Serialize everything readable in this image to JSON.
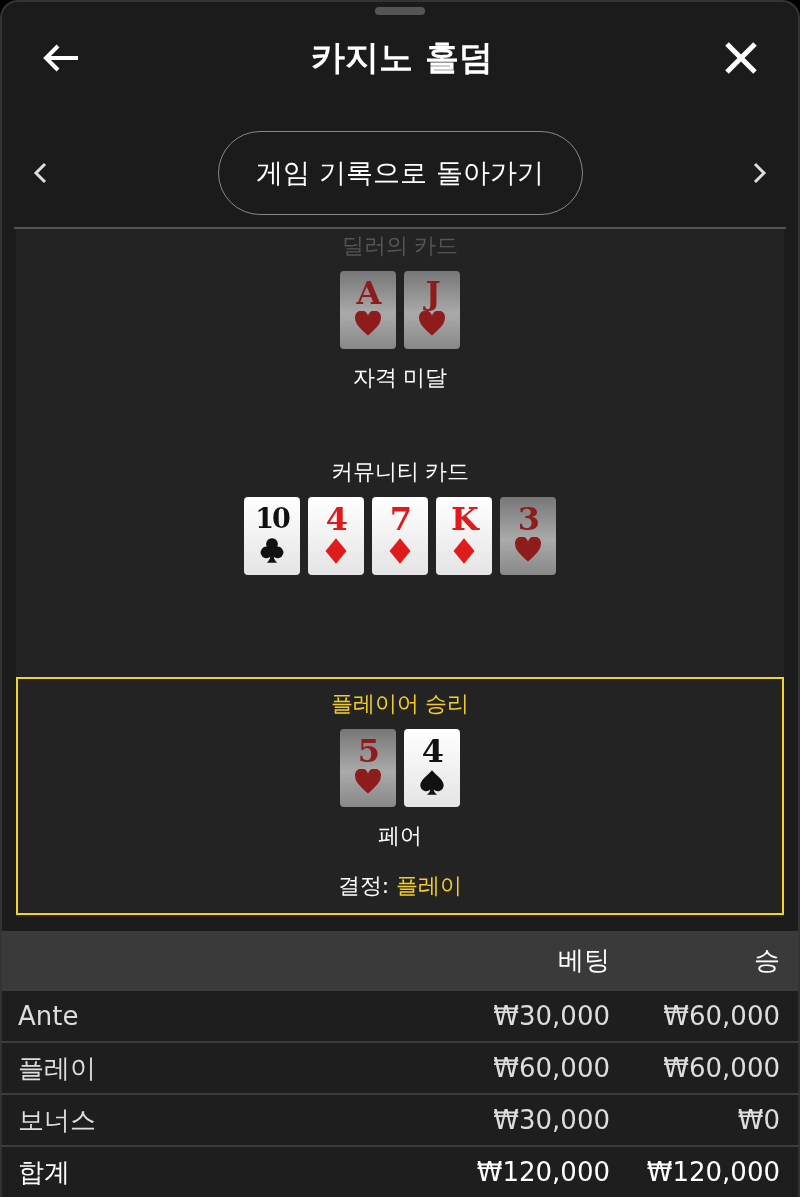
{
  "header": {
    "title": "카지노 홀덤"
  },
  "nav": {
    "back_to_history": "게임 기록으로 돌아가기"
  },
  "hands": [
    {
      "title": "딜러의 카드",
      "title_dimmed": true,
      "highlighted": false,
      "cards": [
        {
          "rank": "A",
          "kind": "hearts",
          "dimmed": true
        },
        {
          "rank": "J",
          "kind": "hearts",
          "dimmed": true
        }
      ],
      "result": "자격 미달"
    },
    {
      "title": "커뮤니티 카드",
      "title_dimmed": false,
      "highlighted": false,
      "cards": [
        {
          "rank": "10",
          "kind": "clubs",
          "dimmed": false
        },
        {
          "rank": "4",
          "kind": "diamonds",
          "dimmed": false
        },
        {
          "rank": "7",
          "kind": "diamonds",
          "dimmed": false
        },
        {
          "rank": "K",
          "kind": "diamonds",
          "dimmed": false
        },
        {
          "rank": "3",
          "kind": "hearts",
          "dimmed": true
        }
      ]
    },
    {
      "title": "플레이어 승리",
      "title_dimmed": false,
      "highlighted": true,
      "cards": [
        {
          "rank": "5",
          "kind": "hearts",
          "dimmed": true
        },
        {
          "rank": "4",
          "kind": "spades",
          "dimmed": false
        }
      ],
      "result": "페어",
      "decision": {
        "label": "결정:",
        "value": "플레이"
      }
    }
  ],
  "table": {
    "columns": [
      "베팅",
      "승"
    ],
    "rows": [
      {
        "name": "Ante",
        "bet": "₩30,000",
        "win": "₩60,000",
        "total": false
      },
      {
        "name": "플레이",
        "bet": "₩60,000",
        "win": "₩60,000",
        "total": false
      },
      {
        "name": "보너스",
        "bet": "₩30,000",
        "win": "₩0",
        "total": false
      },
      {
        "name": "합계",
        "bet": "₩120,000",
        "win": "₩120,000",
        "total": true
      }
    ]
  }
}
